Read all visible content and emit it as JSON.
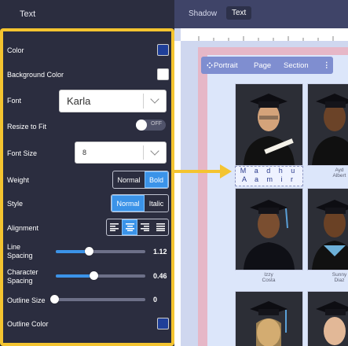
{
  "panel": {
    "title": "Text",
    "color_label": "Color",
    "color_value": "#1f3f99",
    "bg_color_label": "Background Color",
    "bg_color_value": "#ffffff",
    "font_label": "Font",
    "font_value": "Karla",
    "resize_label": "Resize to Fit",
    "resize_state": "OFF",
    "font_size_label": "Font Size",
    "font_size_value": "8",
    "weight_label": "Weight",
    "weight_options": [
      "Normal",
      "Bold"
    ],
    "weight_selected": "Bold",
    "style_label": "Style",
    "style_options": [
      "Normal",
      "Italic"
    ],
    "style_selected": "Normal",
    "alignment_label": "Alignment",
    "alignment_options": [
      "align-left",
      "align-center",
      "align-right",
      "align-justify"
    ],
    "alignment_selected": "align-center",
    "line_spacing_label_1": "Line",
    "line_spacing_label_2": "Spacing",
    "line_spacing_value": "1.12",
    "line_spacing_fraction": 0.37,
    "char_spacing_label_1": "Character",
    "char_spacing_label_2": "Spacing",
    "char_spacing_value": "0.46",
    "char_spacing_fraction": 0.42,
    "outline_size_label": "Outline Size",
    "outline_size_value": "0",
    "outline_size_fraction": 0.0,
    "outline_color_label": "Outline Color",
    "outline_color_value": "#1f3f99",
    "accent": "#3b93e8",
    "highlight": "#f4c430"
  },
  "header": {
    "tabs": [
      "Shadow",
      "Text"
    ],
    "active_tab": "Text"
  },
  "canvas": {
    "toolbar": {
      "portrait": "Portrait",
      "page": "Page",
      "section": "Section",
      "more": "⋮"
    },
    "selected_text_line1": "M a d h u",
    "selected_text_line2": "A a m i r",
    "captions": [
      {
        "line1": "Ayd",
        "line2": "Albert"
      },
      {
        "line1": "Izzy",
        "line2": "Costa"
      },
      {
        "line1": "Sunny",
        "line2": "Diaz"
      }
    ]
  }
}
